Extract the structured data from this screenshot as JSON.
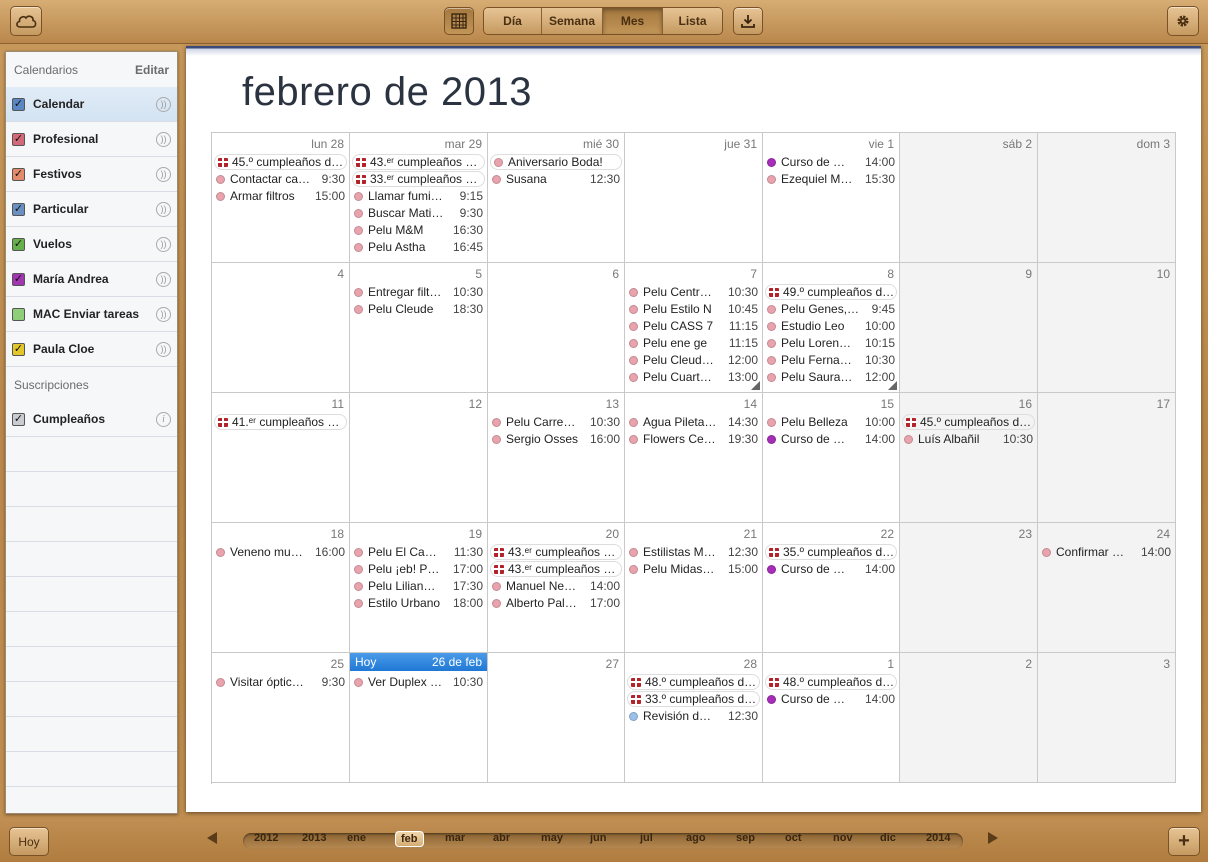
{
  "toolbar": {
    "cloud_icon": "cloud-icon",
    "calendar_icon": "calendar-grid-icon",
    "views": [
      "Día",
      "Semana",
      "Mes",
      "Lista"
    ],
    "selected_view": "Mes",
    "download_icon": "download-icon",
    "settings_icon": "gear-icon"
  },
  "sidebar": {
    "calendars_header": "Calendarios",
    "edit_label": "Editar",
    "calendars": [
      {
        "label": "Calendar",
        "color": "#5b86c4",
        "checked": true,
        "selected": true
      },
      {
        "label": "Profesional",
        "color": "#d46a78",
        "checked": true
      },
      {
        "label": "Festivos",
        "color": "#e58a6a",
        "checked": true
      },
      {
        "label": "Particular",
        "color": "#6a8fc0",
        "checked": true
      },
      {
        "label": "Vuelos",
        "color": "#66b04c",
        "checked": true
      },
      {
        "label": "María Andrea",
        "color": "#a235b0",
        "checked": true
      },
      {
        "label": "MAC Enviar tareas",
        "color": "#8fcf7a",
        "checked": false
      },
      {
        "label": "Paula Cloe",
        "color": "#e3c72a",
        "checked": true
      }
    ],
    "subscriptions_header": "Suscripciones",
    "subscriptions": [
      {
        "label": "Cumpleaños",
        "color": "#8a8a8a",
        "checked": true
      }
    ]
  },
  "month_title": "febrero de 2013",
  "colors": {
    "pink": "#e8a3ad",
    "purple": "#a52db7",
    "blue": "#9cc0e8"
  },
  "weeks": [
    [
      {
        "label": "lun 28",
        "events": [
          {
            "gift": true,
            "text": "45.º cumpleaños de…"
          },
          {
            "color": "pink",
            "text": "Contactar ca…",
            "time": "9:30"
          },
          {
            "color": "pink",
            "text": "Armar filtros",
            "time": "15:00"
          }
        ]
      },
      {
        "label": "mar 29",
        "events": [
          {
            "gift": true,
            "text": "43.ᵉʳ cumpleaños de…"
          },
          {
            "gift": true,
            "text": "33.ᵉʳ cumpleaños de…"
          },
          {
            "color": "pink",
            "text": "Llamar fumi…",
            "time": "9:15"
          },
          {
            "color": "pink",
            "text": "Buscar Mati…",
            "time": "9:30"
          },
          {
            "color": "pink",
            "text": "Pelu M&M",
            "time": "16:30"
          },
          {
            "color": "pink",
            "text": "Pelu Astha",
            "time": "16:45"
          }
        ]
      },
      {
        "label": "mié 30",
        "events": [
          {
            "color": "pink",
            "text": "Aniversario Boda!",
            "allday": true
          },
          {
            "color": "pink",
            "text": "Susana",
            "time": "12:30"
          }
        ]
      },
      {
        "label": "jue 31",
        "events": []
      },
      {
        "label": "vie 1",
        "events": [
          {
            "color": "purple",
            "text": "Curso de …",
            "time": "14:00"
          },
          {
            "color": "pink",
            "text": "Ezequiel M…",
            "time": "15:30"
          }
        ]
      },
      {
        "label": "sáb 2",
        "weekend": true,
        "events": []
      },
      {
        "label": "dom 3",
        "weekend": true,
        "events": []
      }
    ],
    [
      {
        "label": "4",
        "events": []
      },
      {
        "label": "5",
        "events": [
          {
            "color": "pink",
            "text": "Entregar filt…",
            "time": "10:30"
          },
          {
            "color": "pink",
            "text": "Pelu Cleude",
            "time": "18:30"
          }
        ]
      },
      {
        "label": "6",
        "events": []
      },
      {
        "label": "7",
        "more": true,
        "events": [
          {
            "color": "pink",
            "text": "Pelu Centr…",
            "time": "10:30"
          },
          {
            "color": "pink",
            "text": "Pelu Estilo N",
            "time": "10:45"
          },
          {
            "color": "pink",
            "text": "Pelu CASS 7",
            "time": "11:15"
          },
          {
            "color": "pink",
            "text": "Pelu ene ge",
            "time": "11:15"
          },
          {
            "color": "pink",
            "text": "Pelu Cleud…",
            "time": "12:00"
          },
          {
            "color": "pink",
            "text": "Pelu Cuart…",
            "time": "13:00"
          }
        ]
      },
      {
        "label": "8",
        "more": true,
        "events": [
          {
            "gift": true,
            "text": "49.º cumpleaños de…"
          },
          {
            "color": "pink",
            "text": "Pelu Genes,…",
            "time": "9:45"
          },
          {
            "color": "pink",
            "text": "Estudio Leo",
            "time": "10:00"
          },
          {
            "color": "pink",
            "text": "Pelu Loren…",
            "time": "10:15"
          },
          {
            "color": "pink",
            "text": "Pelu Ferna…",
            "time": "10:30"
          },
          {
            "color": "pink",
            "text": "Pelu Saura…",
            "time": "12:00"
          }
        ]
      },
      {
        "label": "9",
        "weekend": true,
        "events": []
      },
      {
        "label": "10",
        "weekend": true,
        "events": []
      }
    ],
    [
      {
        "label": "11",
        "events": [
          {
            "gift": true,
            "text": "41.ᵉʳ cumpleaños de…"
          }
        ]
      },
      {
        "label": "12",
        "events": []
      },
      {
        "label": "13",
        "events": [
          {
            "color": "pink",
            "text": "Pelu Carre…",
            "time": "10:30"
          },
          {
            "color": "pink",
            "text": "Sergio Osses",
            "time": "16:00"
          }
        ]
      },
      {
        "label": "14",
        "events": [
          {
            "color": "pink",
            "text": "Agua Pileta…",
            "time": "14:30"
          },
          {
            "color": "pink",
            "text": "Flowers Ce…",
            "time": "19:30"
          }
        ]
      },
      {
        "label": "15",
        "events": [
          {
            "color": "pink",
            "text": "Pelu Belleza",
            "time": "10:00"
          },
          {
            "color": "purple",
            "text": "Curso de …",
            "time": "14:00"
          }
        ]
      },
      {
        "label": "16",
        "weekend": true,
        "events": [
          {
            "gift": true,
            "text": "45.º cumpleaños de…"
          },
          {
            "color": "pink",
            "text": "Luís Albañil",
            "time": "10:30"
          }
        ]
      },
      {
        "label": "17",
        "weekend": true,
        "events": []
      }
    ],
    [
      {
        "label": "18",
        "events": [
          {
            "color": "pink",
            "text": "Veneno mu…",
            "time": "16:00"
          }
        ]
      },
      {
        "label": "19",
        "events": [
          {
            "color": "pink",
            "text": "Pelu El Ca…",
            "time": "11:30"
          },
          {
            "color": "pink",
            "text": "Pelu ¡eb! P…",
            "time": "17:00"
          },
          {
            "color": "pink",
            "text": "Pelu Lilian…",
            "time": "17:30"
          },
          {
            "color": "pink",
            "text": "Estilo Urbano",
            "time": "18:00"
          }
        ]
      },
      {
        "label": "20",
        "events": [
          {
            "gift": true,
            "text": "43.ᵉʳ cumpleaños de…"
          },
          {
            "gift": true,
            "text": "43.ᵉʳ cumpleaños de…"
          },
          {
            "color": "pink",
            "text": "Manuel Ne…",
            "time": "14:00"
          },
          {
            "color": "pink",
            "text": "Alberto Pal…",
            "time": "17:00"
          }
        ]
      },
      {
        "label": "21",
        "events": [
          {
            "color": "pink",
            "text": "Estilistas M…",
            "time": "12:30"
          },
          {
            "color": "pink",
            "text": "Pelu Midas…",
            "time": "15:00"
          }
        ]
      },
      {
        "label": "22",
        "events": [
          {
            "gift": true,
            "text": "35.º cumpleaños de…"
          },
          {
            "color": "purple",
            "text": "Curso de …",
            "time": "14:00"
          }
        ]
      },
      {
        "label": "23",
        "weekend": true,
        "events": []
      },
      {
        "label": "24",
        "weekend": true,
        "events": [
          {
            "color": "pink",
            "text": "Confirmar …",
            "time": "14:00"
          }
        ]
      }
    ],
    [
      {
        "label": "25",
        "events": [
          {
            "color": "pink",
            "text": "Visitar óptic…",
            "time": "9:30"
          }
        ]
      },
      {
        "label": "",
        "today": true,
        "today_label": "Hoy",
        "today_date": "26 de feb",
        "events": [
          {
            "color": "pink",
            "text": "Ver Duplex …",
            "time": "10:30"
          }
        ]
      },
      {
        "label": "27",
        "events": []
      },
      {
        "label": "28",
        "events": [
          {
            "gift": true,
            "text": "48.º cumpleaños de…"
          },
          {
            "gift": true,
            "text": "33.º cumpleaños de…"
          },
          {
            "color": "blue",
            "text": "Revisión d…",
            "time": "12:30"
          }
        ]
      },
      {
        "label": "1",
        "events": [
          {
            "gift": true,
            "text": "48.º cumpleaños de…"
          },
          {
            "color": "purple",
            "text": "Curso de …",
            "time": "14:00"
          }
        ]
      },
      {
        "label": "2",
        "weekend": true,
        "events": []
      },
      {
        "label": "3",
        "weekend": true,
        "events": []
      }
    ]
  ],
  "bottom": {
    "today_button": "Hoy",
    "years": [
      "2012",
      "2013",
      "2014"
    ],
    "months": [
      "ene",
      "feb",
      "mar",
      "abr",
      "may",
      "jun",
      "jul",
      "ago",
      "sep",
      "oct",
      "nov",
      "dic"
    ],
    "selected_month": "feb",
    "add_label": "+"
  }
}
